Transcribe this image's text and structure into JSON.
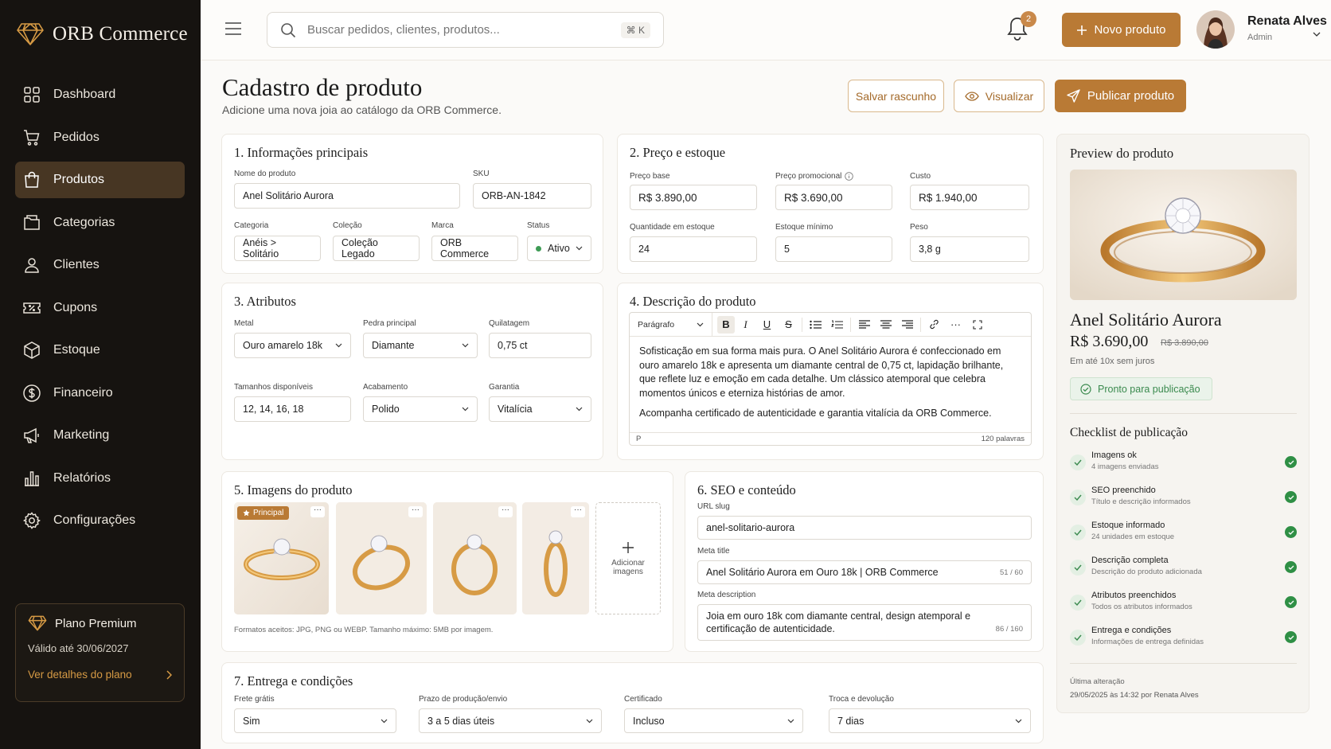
{
  "brand": {
    "name": "ORB Commerce",
    "accent": "#b97a35",
    "sidebar_bg": "#161310",
    "active_bg": "#473623"
  },
  "sidebar": {
    "items": [
      {
        "label": "Dashboard",
        "icon": "grid-icon",
        "active": false
      },
      {
        "label": "Pedidos",
        "icon": "cart-icon",
        "active": false
      },
      {
        "label": "Produtos",
        "icon": "bag-icon",
        "active": true
      },
      {
        "label": "Categorias",
        "icon": "folder-icon",
        "active": false
      },
      {
        "label": "Clientes",
        "icon": "user-icon",
        "active": false
      },
      {
        "label": "Cupons",
        "icon": "coupon-icon",
        "active": false
      },
      {
        "label": "Estoque",
        "icon": "box-icon",
        "active": false
      },
      {
        "label": "Financeiro",
        "icon": "dollar-icon",
        "active": false
      },
      {
        "label": "Marketing",
        "icon": "megaphone-icon",
        "active": false
      },
      {
        "label": "Relatórios",
        "icon": "chart-icon",
        "active": false
      },
      {
        "label": "Configurações",
        "icon": "gear-icon",
        "active": false
      }
    ],
    "plan": {
      "title": "Plano Premium",
      "valid": "Válido até 30/06/2027",
      "link": "Ver detalhes do plano"
    }
  },
  "topbar": {
    "search_placeholder": "Buscar pedidos, clientes, produtos...",
    "shortcut": "⌘ K",
    "notifications": "2",
    "new_product": "Novo produto",
    "user_name": "Renata Alves",
    "user_role": "Admin"
  },
  "header": {
    "title": "Cadastro de produto",
    "subtitle": "Adicione uma nova joia ao catálogo da ORB Commerce.",
    "save_draft": "Salvar rascunho",
    "preview": "Visualizar",
    "publish": "Publicar produto"
  },
  "info": {
    "title": "1. Informações principais",
    "name_label": "Nome do produto",
    "name_value": "Anel Solitário Aurora",
    "sku_label": "SKU",
    "sku_value": "ORB-AN-1842",
    "category_label": "Categoria",
    "category_value": "Anéis > Solitário",
    "collection_label": "Coleção",
    "collection_value": "Coleção Legado",
    "brand_label": "Marca",
    "brand_value": "ORB Commerce",
    "status_label": "Status",
    "status_value": "Ativo"
  },
  "price": {
    "title": "2. Preço e estoque",
    "base_label": "Preço base",
    "base_value": "R$ 3.890,00",
    "promo_label": "Preço promocional",
    "promo_value": "R$ 3.690,00",
    "cost_label": "Custo",
    "cost_value": "R$ 1.940,00",
    "qty_label": "Quantidade em estoque",
    "qty_value": "24",
    "min_label": "Estoque mínimo",
    "min_value": "5",
    "weight_label": "Peso",
    "weight_value": "3,8 g"
  },
  "attributes": {
    "title": "3. Atributos",
    "metal_label": "Metal",
    "metal_value": "Ouro amarelo 18k",
    "stone_label": "Pedra principal",
    "stone_value": "Diamante",
    "carat_label": "Quilatagem",
    "carat_value": "0,75 ct",
    "sizes_label": "Tamanhos disponíveis",
    "sizes_value": "12, 14, 16, 18",
    "finish_label": "Acabamento",
    "finish_value": "Polido",
    "warranty_label": "Garantia",
    "warranty_value": "Vitalícia"
  },
  "description": {
    "title": "4. Descrição do produto",
    "format": "Parágrafo",
    "paragraph1": "Sofisticação em sua forma mais pura. O Anel Solitário Aurora é confeccionado em ouro amarelo 18k e apresenta um diamante central de 0,75 ct, lapidação brilhante, que reflete luz e emoção em cada detalhe. Um clássico atemporal que celebra momentos únicos e eterniza histórias de amor.",
    "paragraph2": "Acompanha certificado de autenticidade e garantia vitalícia da ORB Commerce.",
    "path": "P",
    "word_count": "120 palavras"
  },
  "images": {
    "title": "5. Imagens do produto",
    "main_badge": "Principal",
    "add_label": "Adicionar imagens",
    "formats": "Formatos aceitos: JPG, PNG ou WEBP. Tamanho máximo: 5MB por imagem."
  },
  "seo": {
    "title": "6. SEO e conteúdo",
    "slug_label": "URL slug",
    "slug_value": "anel-solitario-aurora",
    "meta_title_label": "Meta title",
    "meta_title_value": "Anel Solitário Aurora em Ouro 18k | ORB Commerce",
    "meta_title_count": "51 / 60",
    "meta_desc_label": "Meta description",
    "meta_desc_value": "Joia em ouro 18k com diamante central, design atemporal e certificação de autenticidade.",
    "meta_desc_count": "86 / 160"
  },
  "delivery": {
    "title": "7. Entrega e condições",
    "shipping_label": "Frete grátis",
    "shipping_value": "Sim",
    "lead_label": "Prazo de produção/envio",
    "lead_value": "3 a 5 dias úteis",
    "cert_label": "Certificado",
    "cert_value": "Incluso",
    "return_label": "Troca e devolução",
    "return_value": "7 dias"
  },
  "preview": {
    "title": "Preview do produto",
    "name": "Anel Solitário Aurora",
    "price": "R$ 3.690,00",
    "old_price": "R$ 3.890,00",
    "installments": "Em até 10x sem juros",
    "ready": "Pronto para publicação",
    "checklist_title": "Checklist de publicação",
    "checklist": [
      {
        "name": "Imagens ok",
        "desc": "4 imagens enviadas"
      },
      {
        "name": "SEO preenchido",
        "desc": "Título e descrição informados"
      },
      {
        "name": "Estoque informado",
        "desc": "24 unidades em estoque"
      },
      {
        "name": "Descrição completa",
        "desc": "Descrição do produto adicionada"
      },
      {
        "name": "Atributos preenchidos",
        "desc": "Todos os atributos informados"
      },
      {
        "name": "Entrega e condições",
        "desc": "Informações de entrega definidas"
      }
    ],
    "last_change_label": "Última alteração",
    "last_change_value": "29/05/2025 às 14:32 por Renata Alves"
  }
}
